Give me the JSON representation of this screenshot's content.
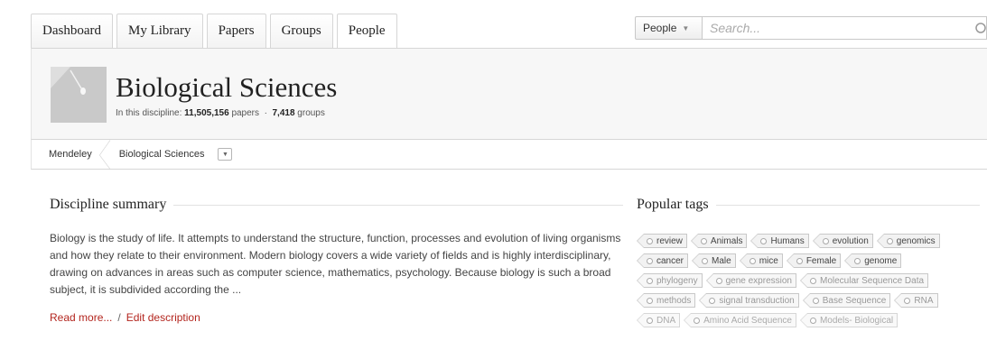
{
  "nav": {
    "tabs": [
      {
        "label": "Dashboard"
      },
      {
        "label": "My Library"
      },
      {
        "label": "Papers"
      },
      {
        "label": "Groups"
      },
      {
        "label": "People"
      }
    ]
  },
  "search": {
    "scope": "People",
    "placeholder": "Search..."
  },
  "discipline": {
    "title": "Biological Sciences",
    "stats_prefix": "In this discipline:",
    "papers_count": "11,505,156",
    "papers_label": "papers",
    "separator": "·",
    "groups_count": "7,418",
    "groups_label": "groups"
  },
  "breadcrumb": {
    "items": [
      "Mendeley",
      "Biological Sciences"
    ]
  },
  "summary": {
    "heading": "Discipline summary",
    "text": "Biology is the study of life. It attempts to understand the structure, function, processes and evolution of living organisms and how they relate to their environment. Modern biology covers a wide variety of fields and is highly interdisciplinary, drawing on advances in areas such as computer science, mathematics, psychology. Because biology is such a broad subject, it is subdivided according the ...",
    "read_more": "Read more...",
    "link_sep": "/",
    "edit": "Edit description"
  },
  "tags": {
    "heading": "Popular tags",
    "rows": [
      [
        "review",
        "Animals",
        "Humans",
        "evolution",
        "genomics"
      ],
      [
        "cancer",
        "Male",
        "mice",
        "Female",
        "genome"
      ],
      [
        "phylogeny",
        "gene expression",
        "Molecular Sequence Data"
      ],
      [
        "methods",
        "signal transduction",
        "Base Sequence",
        "RNA"
      ],
      [
        "DNA",
        "Amino Acid Sequence",
        "Models- Biological"
      ]
    ]
  },
  "colors": {
    "link": "#b3251e",
    "header_bg": "#f7f7f7"
  }
}
